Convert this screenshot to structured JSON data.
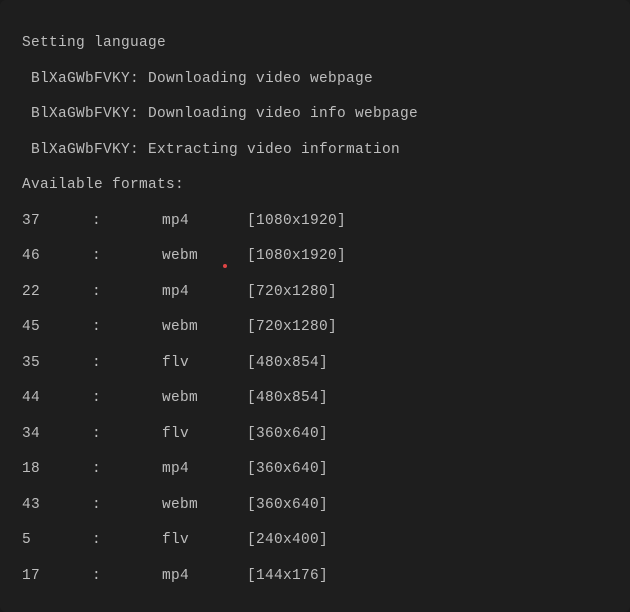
{
  "output": {
    "intro": [
      {
        "text": "Setting language",
        "indent": false
      },
      {
        "text": "BlXaGWbFVKY: Downloading video webpage",
        "indent": true
      },
      {
        "text": "BlXaGWbFVKY: Downloading video info webpage",
        "indent": true
      },
      {
        "text": "BlXaGWbFVKY: Extracting video information",
        "indent": true
      },
      {
        "text": "Available formats:",
        "indent": false
      }
    ],
    "separator": ":",
    "formats": [
      {
        "code": "37",
        "ext": "mp4",
        "res": "[1080x1920]",
        "caret": false
      },
      {
        "code": "46",
        "ext": "webm",
        "res": "[1080x1920]",
        "caret": true
      },
      {
        "code": "22",
        "ext": "mp4",
        "res": "[720x1280]",
        "caret": false
      },
      {
        "code": "45",
        "ext": "webm",
        "res": "[720x1280]",
        "caret": false
      },
      {
        "code": "35",
        "ext": "flv",
        "res": "[480x854]",
        "caret": false
      },
      {
        "code": "44",
        "ext": "webm",
        "res": "[480x854]",
        "caret": false
      },
      {
        "code": "34",
        "ext": "flv",
        "res": "[360x640]",
        "caret": false
      },
      {
        "code": "18",
        "ext": "mp4",
        "res": "[360x640]",
        "caret": false
      },
      {
        "code": "43",
        "ext": "webm",
        "res": "[360x640]",
        "caret": false
      },
      {
        "code": "5",
        "ext": "flv",
        "res": "[240x400]",
        "caret": false
      },
      {
        "code": "17",
        "ext": "mp4",
        "res": "[144x176]",
        "caret": false
      }
    ]
  }
}
